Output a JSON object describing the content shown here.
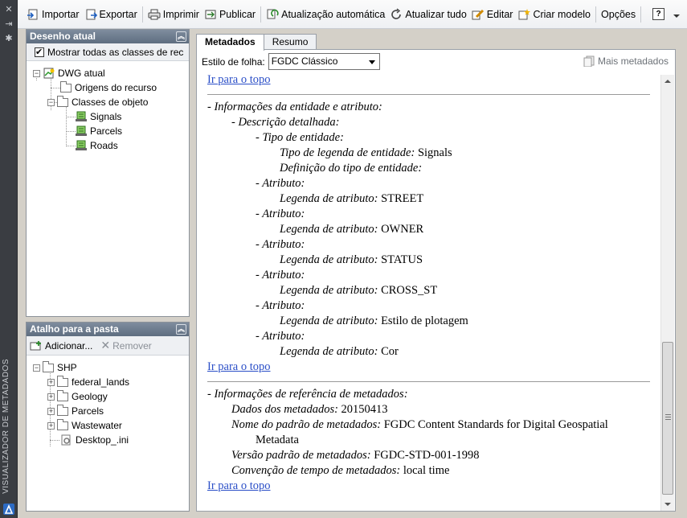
{
  "app": {
    "vertical_title": "VISUALIZADOR DE METADADOS"
  },
  "toolbar": {
    "import": "Importar",
    "export": "Exportar",
    "print": "Imprimir",
    "publish": "Publicar",
    "auto_update": "Atualização automática",
    "update_all": "Atualizar tudo",
    "edit": "Editar",
    "create_template": "Criar modelo",
    "options": "Opções",
    "help": "?"
  },
  "current_drawing": {
    "title": "Desenho atual",
    "show_all_label": "Mostrar todas as classes de rec",
    "tree": {
      "root": "DWG atual",
      "resource_origins": "Origens do recurso",
      "object_classes": "Classes de objeto",
      "classes": [
        "Signals",
        "Parcels",
        "Roads"
      ]
    }
  },
  "folder_shortcut": {
    "title": "Atalho para a pasta",
    "add": "Adicionar...",
    "remove": "Remover",
    "tree": {
      "root": "SHP",
      "folders": [
        "federal_lands",
        "Geology",
        "Parcels",
        "Wastewater"
      ],
      "file": "Desktop_.ini"
    }
  },
  "tabs": {
    "metadata": "Metadados",
    "summary": "Resumo"
  },
  "style": {
    "label": "Estilo de folha:",
    "selected": "FGDC Clássico",
    "more_metadata": "Mais metadados"
  },
  "doc": {
    "goto_top": "Ir para o topo",
    "entity_section": "- Informações da entidade e atributo:",
    "detailed_desc": "- Descrição detalhada:",
    "entity_type": "- Tipo de entidade:",
    "entity_type_label_key": "Tipo de legenda de entidade:",
    "entity_type_label_val": "Signals",
    "entity_type_def_key": "Definição do tipo de entidade:",
    "attribute_header": "- Atributo:",
    "attribute_label_key": "Legenda de atributo:",
    "attributes": [
      "STREET",
      "OWNER",
      "STATUS",
      "CROSS_ST",
      "Estilo de plotagem",
      "Cor"
    ],
    "reference_section": "- Informações de referência de metadados:",
    "metadata_date_key": "Dados dos metadados:",
    "metadata_date_val": "20150413",
    "standard_name_key": "Nome do padrão de metadados:",
    "standard_name_val": "FGDC Content Standards for Digital Geospatial",
    "standard_name_val2": "Metadata",
    "standard_version_key": "Versão padrão de metadados:",
    "standard_version_val": "FGDC-STD-001-1998",
    "time_convention_key": "Convenção de tempo de metadados:",
    "time_convention_val": "local time"
  },
  "colors": {
    "panel_header": "#6b7a8d",
    "link": "#2a4ec7",
    "side_strip": "#3a3d42"
  }
}
